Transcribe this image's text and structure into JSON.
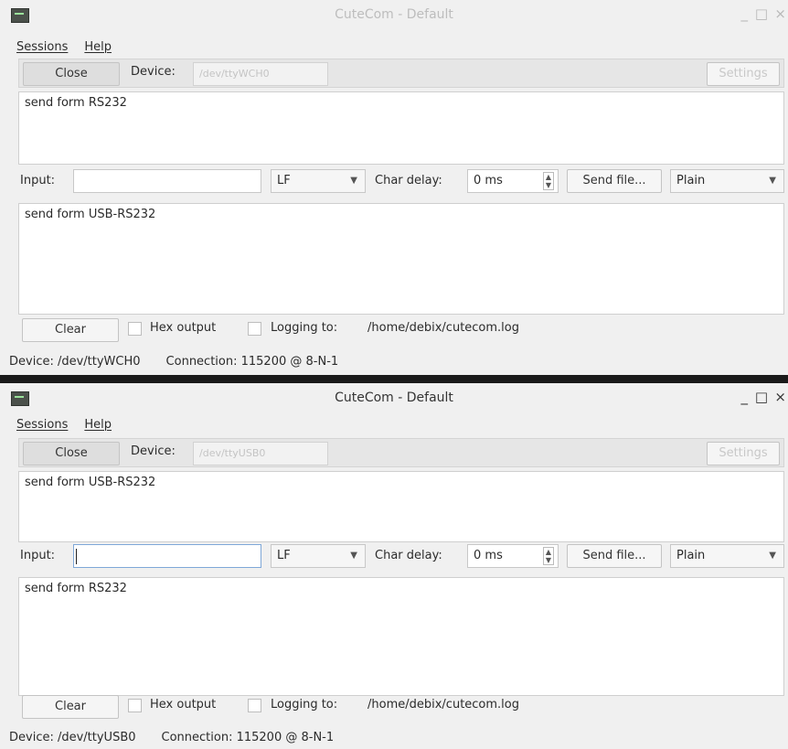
{
  "windows": [
    {
      "title": "CuteCom - Default",
      "window_controls": {
        "minimize": "_",
        "maximize": "□",
        "close": "×"
      },
      "menu": [
        "Sessions",
        "Help"
      ],
      "toolbar": {
        "close_label": "Close",
        "device_label": "Device:",
        "device_value": "/dev/ttyWCH0",
        "settings_label": "Settings"
      },
      "received_text": "send form RS232",
      "input_row": {
        "input_label": "Input:",
        "input_value": "",
        "line_end": "LF",
        "char_delay_label": "Char delay:",
        "char_delay_value": "0 ms",
        "send_file_label": "Send file...",
        "format": "Plain"
      },
      "sent_text": "send form USB-RS232",
      "bottom": {
        "clear_label": "Clear",
        "hex_output_label": "Hex output",
        "logging_label": "Logging to:",
        "log_path": "/home/debix/cutecom.log"
      },
      "status": {
        "device": "Device:  /dev/ttyWCH0",
        "connection": "Connection:  115200 @ 8-N-1"
      }
    },
    {
      "title": "CuteCom - Default",
      "window_controls": {
        "minimize": "_",
        "maximize": "□",
        "close": "×"
      },
      "menu": [
        "Sessions",
        "Help"
      ],
      "toolbar": {
        "close_label": "Close",
        "device_label": "Device:",
        "device_value": "/dev/ttyUSB0",
        "settings_label": "Settings"
      },
      "received_text": "send form USB-RS232",
      "input_row": {
        "input_label": "Input:",
        "input_value": "",
        "line_end": "LF",
        "char_delay_label": "Char delay:",
        "char_delay_value": "0 ms",
        "send_file_label": "Send file...",
        "format": "Plain"
      },
      "sent_text": "send form RS232",
      "bottom": {
        "clear_label": "Clear",
        "hex_output_label": "Hex output",
        "logging_label": "Logging to:",
        "log_path": "/home/debix/cutecom.log"
      },
      "status": {
        "device": "Device:  /dev/ttyUSB0",
        "connection": "Connection:  115200 @ 8-N-1"
      }
    }
  ]
}
